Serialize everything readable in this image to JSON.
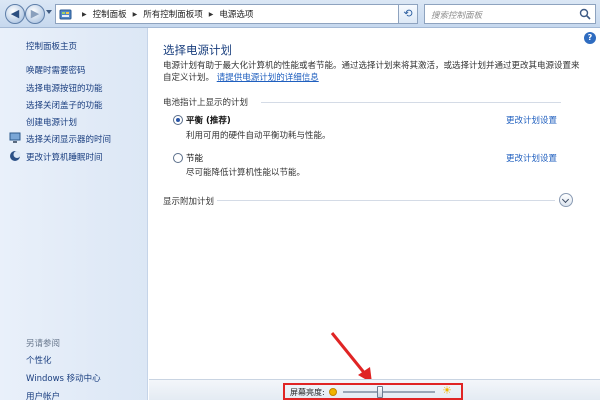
{
  "toolbar": {
    "back_symbol": "◀",
    "forward_symbol": "▶",
    "refresh_symbol": "⟲",
    "breadcrumbs": [
      "控制面板",
      "所有控制面板项",
      "电源选项"
    ],
    "search_placeholder": "搜索控制面板"
  },
  "sidebar": {
    "home_link": "控制面板主页",
    "tasks": [
      {
        "label": "唤醒时需要密码",
        "icon": null
      },
      {
        "label": "选择电源按钮的功能",
        "icon": null
      },
      {
        "label": "选择关闭盖子的功能",
        "icon": null
      },
      {
        "label": "创建电源计划",
        "icon": null
      },
      {
        "label": "选择关闭显示器的时间",
        "icon": "monitor-icon"
      },
      {
        "label": "更改计算机睡眠时间",
        "icon": "moon-icon"
      }
    ],
    "see_also_title": "另请参阅",
    "see_also": [
      "个性化",
      "Windows 移动中心",
      "用户帐户"
    ]
  },
  "main": {
    "help_symbol": "?",
    "title": "选择电源计划",
    "description": "电源计划有助于最大化计算机的性能或者节能。通过选择计划来将其激活，或选择计划并通过更改其电源设置来自定义计划。",
    "description_link": "请提供电源计划的详细信息",
    "battery_section": "电池指计上显示的计划",
    "plans": [
      {
        "name": "平衡 (推荐)",
        "description": "利用可用的硬件自动平衡功耗与性能。",
        "link": "更改计划设置",
        "selected": true
      },
      {
        "name": "节能",
        "description": "尽可能降低计算机性能以节能。",
        "link": "更改计划设置",
        "selected": false
      }
    ],
    "additional_section": "显示附加计划"
  },
  "brightness": {
    "label": "屏幕亮度:",
    "level_percent": 40,
    "high_symbol": "☀"
  },
  "colors": {
    "link": "#1f5fbf",
    "title": "#1a3f7e",
    "annotation": "#e02424"
  }
}
